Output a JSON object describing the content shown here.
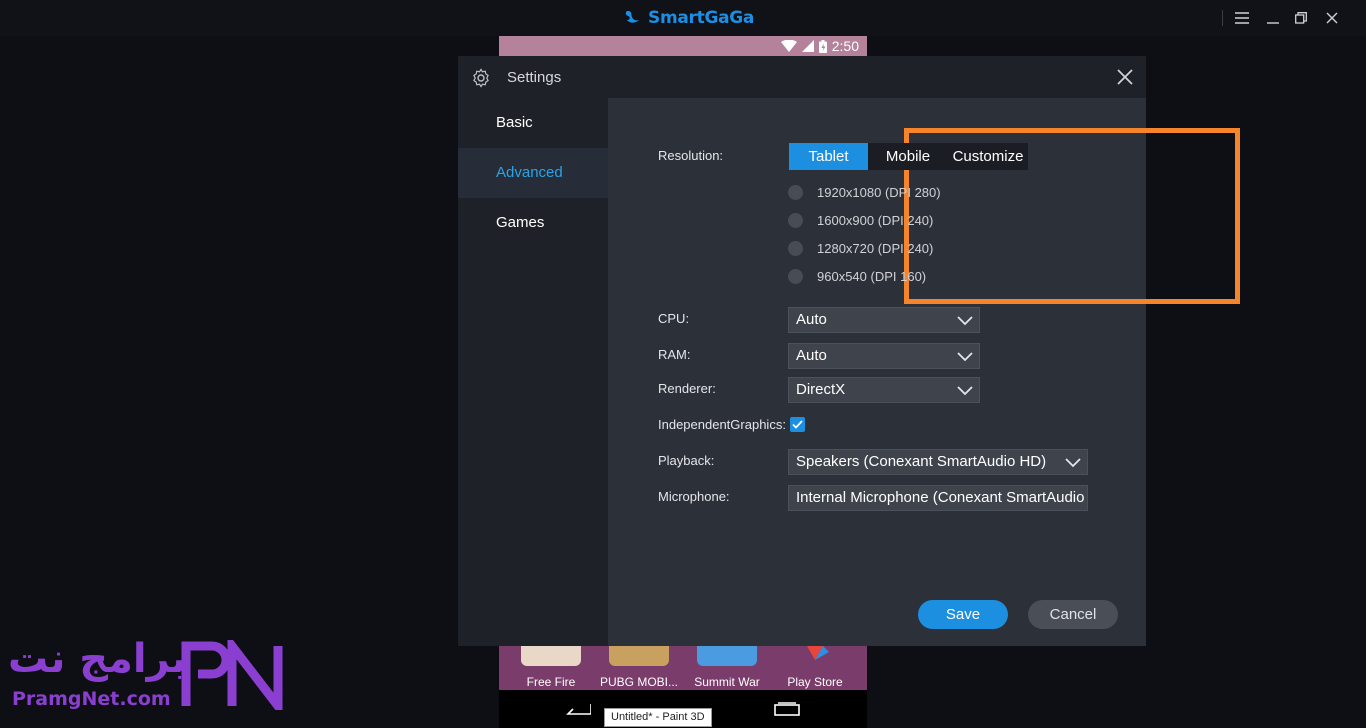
{
  "window": {
    "app_name": "SmartGaGa",
    "controls": [
      "menu",
      "minimize",
      "restore",
      "close"
    ]
  },
  "android": {
    "status_time": "2:50",
    "apps": [
      {
        "label": "Free Fire",
        "color": "#e9d8c8"
      },
      {
        "label": "PUBG MOBI...",
        "color": "#c8a060"
      },
      {
        "label": "Summit War",
        "color": "#4a9be0"
      },
      {
        "label": "Play Store",
        "color": "#7a3c6a"
      }
    ],
    "tooltip": "Untitled* - Paint 3D"
  },
  "dialog": {
    "title": "Settings",
    "sidebar": [
      {
        "label": "Basic",
        "active": false
      },
      {
        "label": "Advanced",
        "active": true
      },
      {
        "label": "Games",
        "active": false
      }
    ],
    "resolution": {
      "label": "Resolution:",
      "tabs": [
        {
          "label": "Tablet",
          "active": true
        },
        {
          "label": "Mobile",
          "active": false
        },
        {
          "label": "Customize",
          "active": false
        }
      ],
      "options": [
        "1920x1080 (DPI 280)",
        "1600x900 (DPI 240)",
        "1280x720 (DPI 240)",
        "960x540 (DPI 160)"
      ]
    },
    "cpu": {
      "label": "CPU:",
      "value": "Auto"
    },
    "ram": {
      "label": "RAM:",
      "value": "Auto"
    },
    "renderer": {
      "label": "Renderer:",
      "value": "DirectX"
    },
    "independent_graphics": {
      "label": "IndependentGraphics:",
      "checked": true
    },
    "playback": {
      "label": "Playback:",
      "value": "Speakers (Conexant SmartAudio HD)"
    },
    "microphone": {
      "label": "Microphone:",
      "value": "Internal Microphone (Conexant SmartAudio HD)"
    },
    "save_label": "Save",
    "cancel_label": "Cancel"
  },
  "watermark": {
    "arabic": "برامج نت",
    "url": "PramgNet.com",
    "logo_text": "PN"
  },
  "colors": {
    "accent": "#1c8fe0",
    "highlight": "#f5842a",
    "active_text": "#2aa4e6"
  }
}
